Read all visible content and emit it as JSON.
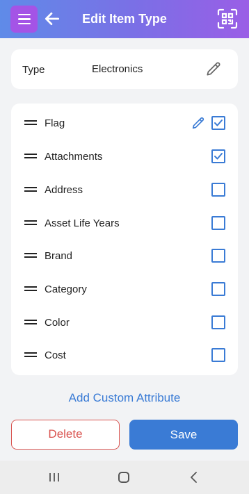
{
  "header": {
    "title": "Edit Item Type",
    "menu_icon": "hamburger-icon",
    "back_icon": "arrow-left-icon",
    "scan_icon": "qr-scan-icon",
    "gradient_colors": [
      "#5f8be8",
      "#9a5ee6"
    ]
  },
  "type_card": {
    "label": "Type",
    "value": "Electronics",
    "edit_icon": "pencil-icon"
  },
  "attributes": [
    {
      "label": "Flag",
      "checked": true,
      "editable": true
    },
    {
      "label": "Attachments",
      "checked": true,
      "editable": false
    },
    {
      "label": "Address",
      "checked": false,
      "editable": false
    },
    {
      "label": "Asset Life Years",
      "checked": false,
      "editable": false
    },
    {
      "label": "Brand",
      "checked": false,
      "editable": false
    },
    {
      "label": "Category",
      "checked": false,
      "editable": false
    },
    {
      "label": "Color",
      "checked": false,
      "editable": false
    },
    {
      "label": "Cost",
      "checked": false,
      "editable": false
    }
  ],
  "add_custom_attribute_label": "Add Custom Attribute",
  "actions": {
    "delete_label": "Delete",
    "save_label": "Save"
  },
  "colors": {
    "accent": "#3a7bd5",
    "danger": "#d9534f",
    "menu_button": "#a454e6"
  }
}
